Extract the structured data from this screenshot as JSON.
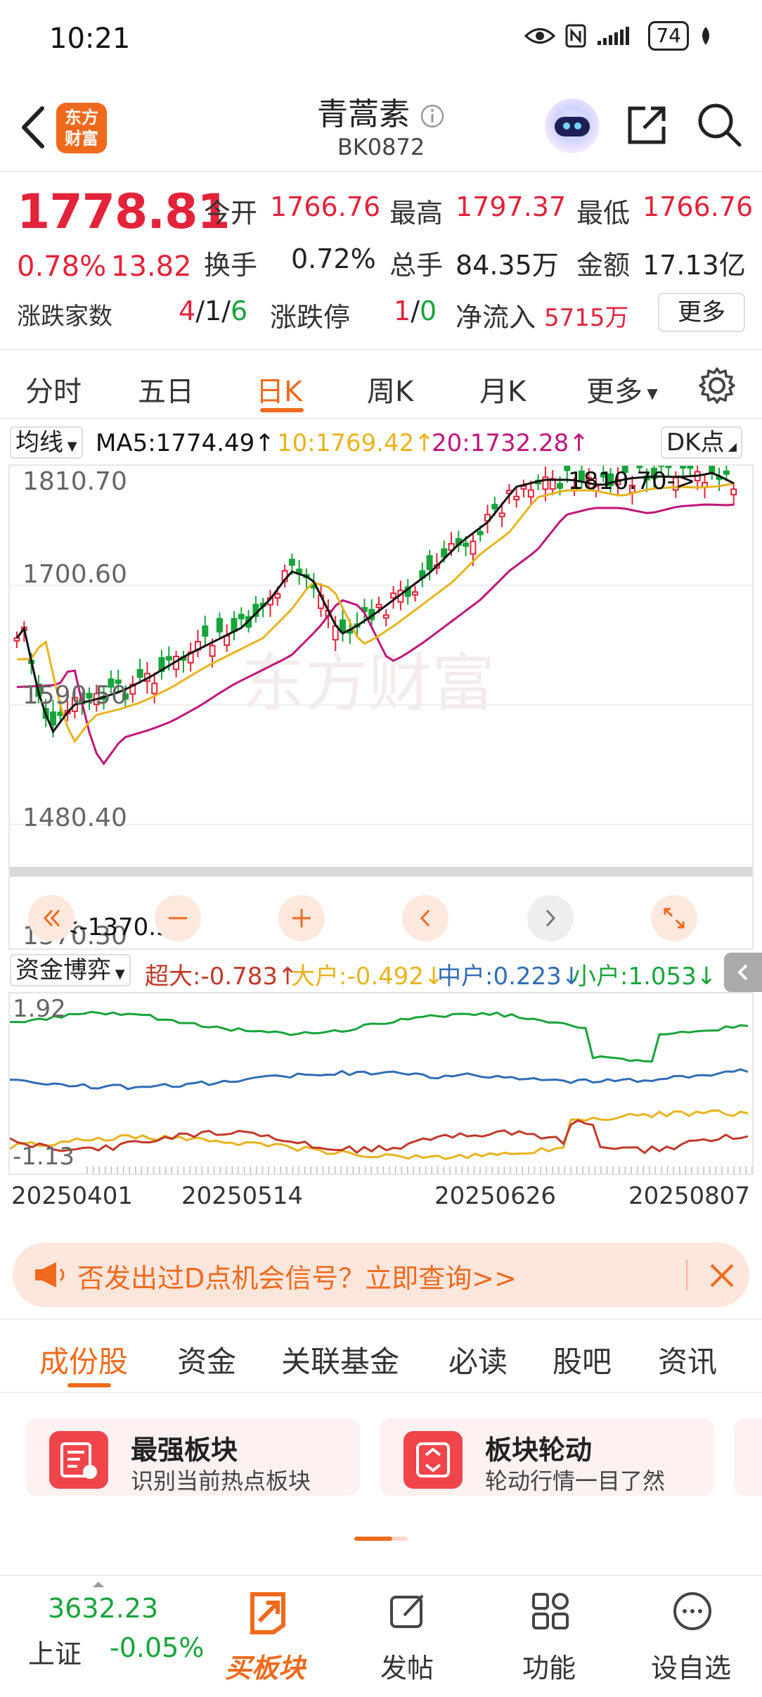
{
  "status_bar": {
    "time": "10:21",
    "battery": "74"
  },
  "header": {
    "logo_line1": "东方",
    "logo_line2": "财富",
    "title": "青蒿素",
    "code": "BK0872"
  },
  "quote": {
    "price": "1778.81",
    "change_pct": "0.78%",
    "change": "13.82",
    "open_label": "今开",
    "open": "1766.76",
    "high_label": "最高",
    "high": "1797.37",
    "low_label": "最低",
    "low": "1766.76",
    "turnover_label": "换手",
    "turnover": "0.72%",
    "volume_label": "总手",
    "volume": "84.35万",
    "amount_label": "金额",
    "amount": "17.13亿",
    "updown_label": "涨跌家数",
    "up_count": "4",
    "flat_count": "1",
    "down_count": "6",
    "limit_label": "涨跌停",
    "limit_up": "1",
    "limit_down": "0",
    "netflow_label": "净流入",
    "netflow": "5715万",
    "more_label": "更多"
  },
  "period_tabs": [
    "分时",
    "五日",
    "日K",
    "周K",
    "月K",
    "更多"
  ],
  "indicator": {
    "ma_selector": "均线",
    "ma5": "MA5:1774.49↑",
    "ma10": "10:1769.42↑",
    "ma20": "20:1732.28↑",
    "dk_label": "DK点"
  },
  "kline": {
    "y_labels": [
      "1810.70",
      "1700.60",
      "1590.50",
      "1480.40",
      "1370.30"
    ],
    "high_marker": "1810.70->",
    "low_marker": "<-1370.30"
  },
  "fund_flow": {
    "selector": "资金博弈",
    "super": "超大:-0.783↑",
    "large": "大户:-0.492↓",
    "medium": "中户:0.223↓",
    "small": "小户:1.053↓",
    "y_top": "1.92",
    "y_bottom": "-1.13"
  },
  "x_labels": [
    "20250401",
    "20250514",
    "20250626",
    "20250807"
  ],
  "banner": {
    "text": "否发出过D点机会信号？立即查询>>"
  },
  "section_tabs": [
    "成份股",
    "资金",
    "关联基金",
    "必读",
    "股吧",
    "资讯"
  ],
  "cards": [
    {
      "title": "最强板块",
      "subtitle": "识别当前热点板块"
    },
    {
      "title": "板块轮动",
      "subtitle": "轮动行情一目了然"
    }
  ],
  "bottom_bar": {
    "index_value": "3632.23",
    "index_name": "上证",
    "index_change": "-0.05%",
    "buy_label": "买板块",
    "post_label": "发帖",
    "func_label": "功能",
    "watch_label": "设自选"
  },
  "colors": {
    "up": "#e2233a",
    "down": "#17a43a",
    "accent": "#f06a1d",
    "ma5": "#111111",
    "ma10": "#e8b31c",
    "ma20": "#c0147a",
    "medium_line": "#2f6db5"
  }
}
